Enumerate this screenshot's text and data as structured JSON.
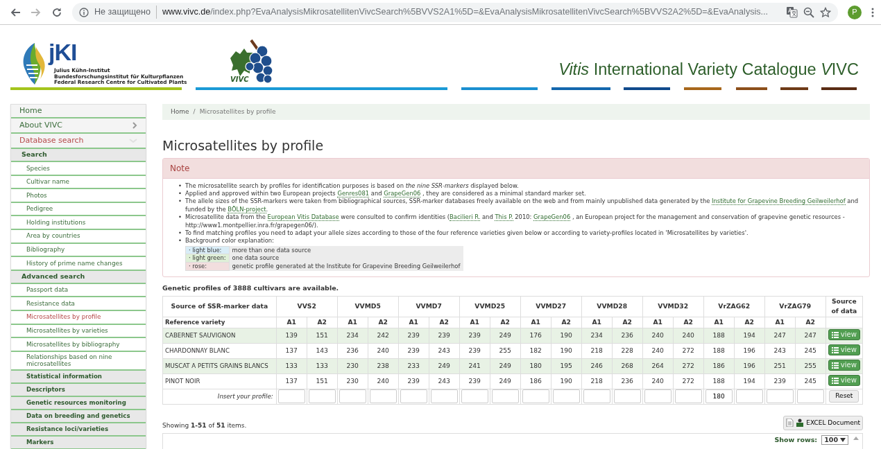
{
  "browser": {
    "nav": [
      {
        "kind": "back",
        "disabled": false
      },
      {
        "kind": "forward",
        "disabled": true
      },
      {
        "kind": "reload",
        "disabled": false
      }
    ],
    "security": "Не защищено",
    "url_host": "www.vivc.de",
    "url_path": "/index.php?EvaAnalysisMikrosatellitenVivcSearch%5BVVS2A1%5D=&EvaAnalysisMikrosatellitenVivcSearch%5BVVS2A2%5D=&EvaAnalysis...",
    "avatar": "P"
  },
  "header": {
    "jki_logo": "jKI",
    "jki_lines": [
      "Julius Kühn-Institut",
      "Bundesforschungsinstitut für Kulturpflanzen",
      "Federal Research Centre for Cultivated Plants"
    ],
    "vivc_logo": "VIVC",
    "title": [
      {
        "text": "Vitis",
        "italic": true
      },
      {
        "text": " International Variety Catalogue ",
        "italic": false
      },
      {
        "text": "V",
        "italic": true
      },
      {
        "text": "IVC",
        "italic": false
      }
    ]
  },
  "sidebar": {
    "items": [
      {
        "kind": "top",
        "label": "Home",
        "selected": false
      },
      {
        "kind": "top",
        "label": "About VIVC",
        "selected": false,
        "expanded": false
      },
      {
        "kind": "top",
        "label": "Database search",
        "selected": true,
        "expanded": true
      },
      {
        "kind": "section",
        "label": "Search",
        "selected": false
      },
      {
        "kind": "link",
        "label": "Species",
        "selected": false
      },
      {
        "kind": "link",
        "label": "Cultivar name",
        "selected": false
      },
      {
        "kind": "link",
        "label": "Photos",
        "selected": false
      },
      {
        "kind": "link",
        "label": "Pedigree",
        "selected": false
      },
      {
        "kind": "link",
        "label": "Holding institutions",
        "selected": false
      },
      {
        "kind": "link",
        "label": "Area by countries",
        "selected": false
      },
      {
        "kind": "link",
        "label": "Bibliography",
        "selected": false
      },
      {
        "kind": "link",
        "label": "History of prime name changes",
        "selected": false
      },
      {
        "kind": "section",
        "label": "Advanced search",
        "selected": false
      },
      {
        "kind": "link",
        "label": "Passport data",
        "selected": false
      },
      {
        "kind": "link",
        "label": "Resistance data",
        "selected": false
      },
      {
        "kind": "link",
        "label": "Microsatellites by profile",
        "selected": true
      },
      {
        "kind": "link",
        "label": "Microsatellites by varieties",
        "selected": false
      },
      {
        "kind": "link",
        "label": "Microsatellites by bibliography",
        "selected": false
      },
      {
        "kind": "link",
        "label": "Relationships based on nine microsatellites",
        "selected": false
      },
      {
        "kind": "group",
        "label": "Statistical information",
        "selected": false
      },
      {
        "kind": "group",
        "label": "Descriptors",
        "selected": false
      },
      {
        "kind": "group",
        "label": "Genetic resources monitoring",
        "selected": false
      },
      {
        "kind": "group",
        "label": "Data on breeding and genetics",
        "selected": false
      },
      {
        "kind": "group",
        "label": "Resistance loci/varieties",
        "selected": false
      },
      {
        "kind": "group",
        "label": "Markers",
        "selected": false
      }
    ]
  },
  "breadcrumb": {
    "separator": "/",
    "items": [
      {
        "label": "Home",
        "selected": false
      },
      {
        "label": "Microsatellites by profile",
        "selected": true
      }
    ]
  },
  "heading": "Microsatellites by profile",
  "note": {
    "title": "Note",
    "bullets": [
      {
        "marker": "•",
        "segments": [
          {
            "text": "The microsatellite search by profiles for identification purposes is based on *the nine SSR-markers* displayed below."
          }
        ]
      },
      {
        "marker": "•",
        "segments": [
          {
            "text": "Applied and approved within two European projects "
          },
          {
            "link": "Genres081"
          },
          {
            "text": " and "
          },
          {
            "link": "GrapeGen06"
          },
          {
            "text": " , they are considered as a minimal standard marker set."
          }
        ]
      },
      {
        "marker": "•",
        "segments": [
          {
            "text": "The allele sizes of the SSR-markers were taken from bibliographical sources, SSR-marker databases freely available on the web and from mainly unpublished data generated by the "
          },
          {
            "link": "Institute for Grapevine Breeding Geilweilerhof"
          },
          {
            "text": " and funded by the "
          },
          {
            "link": "BÖLN-project"
          },
          {
            "text": "."
          }
        ]
      },
      {
        "marker": "•",
        "segments": [
          {
            "text": "Microsatellite data from the "
          },
          {
            "link": "European Vitis Database"
          },
          {
            "text": " were consulted to confirm identities ("
          },
          {
            "link": "Bacilieri R."
          },
          {
            "text": " and "
          },
          {
            "link": "This P."
          },
          {
            "text": " 2010: "
          },
          {
            "link": "GrapeGen06"
          },
          {
            "text": " , an European project for the management and conservation of grapevine genetic resources - http://www1.montpellier.inra.fr/grapegen06/)."
          }
        ]
      },
      {
        "marker": "•",
        "segments": [
          {
            "text": "To find matching profiles you need to adapt your allele sizes according to those of the four reference varieties given below or according to variety-profiles located in 'Microsatellites by varieties'."
          }
        ]
      },
      {
        "marker": "•",
        "segments": [
          {
            "text": "Background color explanation:"
          }
        ],
        "legend": [
          {
            "label": "· light blue:",
            "description": "more than one data source",
            "color": "#d9edf7"
          },
          {
            "label": "· light green:",
            "description": "one data source",
            "color": "#dff0d8"
          },
          {
            "label": "· rose:",
            "description": "genetic profile generated at the Institute for Grapevine Breeding Geilweilerhof",
            "color": "#f2dede"
          }
        ]
      }
    ]
  },
  "summary": "Genetic profiles of 3888 cultivars are available.",
  "table": {
    "source_header": "Source of SSR-marker data",
    "data_header": "Source of data",
    "reference_label": "Reference variety",
    "markers": [
      {
        "name": "VVS2",
        "alleles": [
          "A1",
          "A2"
        ]
      },
      {
        "name": "VVMD5",
        "alleles": [
          "A1",
          "A2"
        ]
      },
      {
        "name": "VVMD7",
        "alleles": [
          "A1",
          "A2"
        ]
      },
      {
        "name": "VVMD25",
        "alleles": [
          "A1",
          "A2"
        ]
      },
      {
        "name": "VVMD27",
        "alleles": [
          "A1",
          "A2"
        ]
      },
      {
        "name": "VVMD28",
        "alleles": [
          "A1",
          "A2"
        ]
      },
      {
        "name": "VVMD32",
        "alleles": [
          "A1",
          "A2"
        ]
      },
      {
        "name": "VrZAG62",
        "alleles": [
          "A1",
          "A2"
        ],
        "profile_a1": "180"
      },
      {
        "name": "VrZAG79",
        "alleles": [
          "A1",
          "A2"
        ]
      }
    ],
    "rows": [
      {
        "name": "CABERNET SAUVIGNON",
        "color": "#e8f2e5",
        "values": [
          "139",
          "151",
          "234",
          "242",
          "239",
          "239",
          "239",
          "249",
          "176",
          "190",
          "234",
          "236",
          "240",
          "240",
          "188",
          "194",
          "247",
          "247"
        ],
        "button": "view"
      },
      {
        "name": "CHARDONNAY BLANC",
        "color": "#ffffff",
        "values": [
          "137",
          "143",
          "236",
          "240",
          "239",
          "243",
          "239",
          "255",
          "182",
          "190",
          "218",
          "228",
          "240",
          "272",
          "188",
          "196",
          "243",
          "245"
        ],
        "button": "view"
      },
      {
        "name": "MUSCAT A PETITS GRAINS BLANCS",
        "color": "#e8f2e5",
        "values": [
          "133",
          "133",
          "230",
          "238",
          "233",
          "249",
          "241",
          "249",
          "180",
          "195",
          "246",
          "268",
          "264",
          "272",
          "186",
          "196",
          "251",
          "255"
        ],
        "button": "view"
      },
      {
        "name": "PINOT NOIR",
        "color": "#ffffff",
        "values": [
          "137",
          "151",
          "230",
          "240",
          "239",
          "243",
          "239",
          "249",
          "186",
          "190",
          "218",
          "236",
          "240",
          "272",
          "188",
          "194",
          "239",
          "245"
        ],
        "button": "view"
      }
    ],
    "profile_label": "Insert your profile:",
    "reset": "Reset"
  },
  "showing": "Showing **1-51** of **51** items.",
  "export_button": "EXCEL Document",
  "rows_label": "Show rows:",
  "rows_value": "100"
}
